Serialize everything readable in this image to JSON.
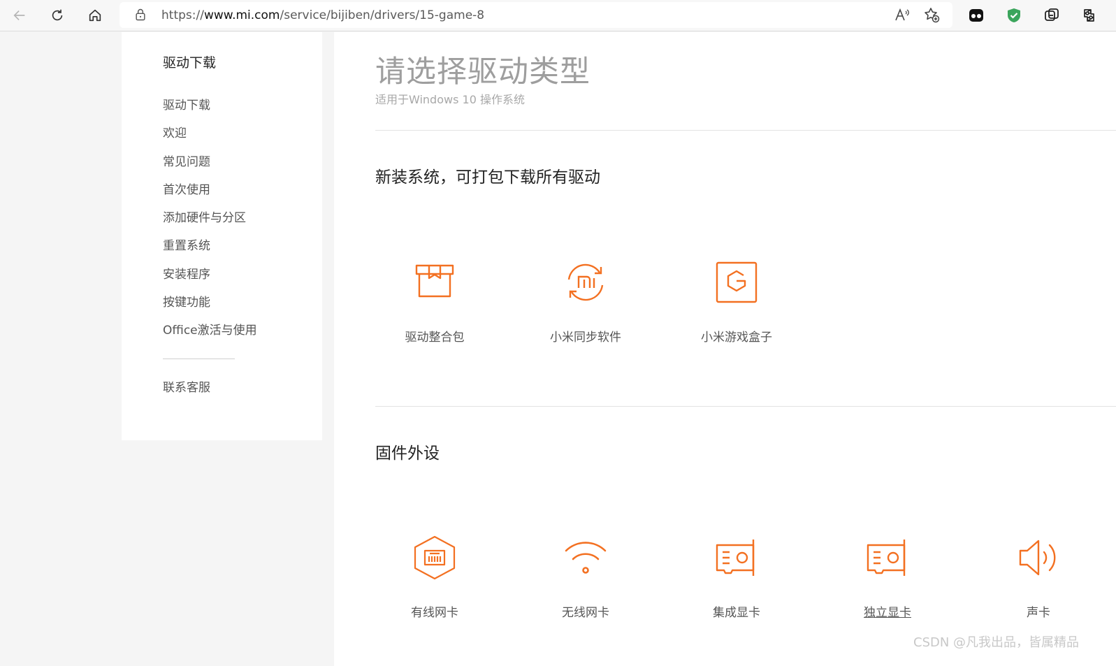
{
  "browser": {
    "url_prefix": "https://",
    "url_domain": "www.mi.com",
    "url_path": "/service/bijiben/drivers/15-game-8"
  },
  "sidebar": {
    "heading": "驱动下载",
    "items": [
      {
        "label": "驱动下载"
      },
      {
        "label": "欢迎"
      },
      {
        "label": "常见问题"
      },
      {
        "label": "首次使用"
      },
      {
        "label": "添加硬件与分区"
      },
      {
        "label": "重置系统"
      },
      {
        "label": "安装程序"
      },
      {
        "label": "按键功能"
      },
      {
        "label": "Office激活与使用"
      }
    ],
    "contact": "联系客服"
  },
  "main": {
    "title": "请选择驱动类型",
    "subtitle": "适用于Windows 10 操作系统",
    "sections": [
      {
        "title": "新装系统，可打包下载所有驱动",
        "items": [
          {
            "label": "驱动整合包",
            "icon": "package-icon"
          },
          {
            "label": "小米同步软件",
            "icon": "mi-sync-icon"
          },
          {
            "label": "小米游戏盒子",
            "icon": "game-box-icon"
          }
        ]
      },
      {
        "title": "固件外设",
        "items": [
          {
            "label": "有线网卡",
            "icon": "ethernet-icon"
          },
          {
            "label": "无线网卡",
            "icon": "wifi-icon"
          },
          {
            "label": "集成显卡",
            "icon": "graphics-card-icon"
          },
          {
            "label": "独立显卡",
            "icon": "graphics-card-icon"
          },
          {
            "label": "声卡",
            "icon": "speaker-icon"
          }
        ]
      }
    ]
  },
  "watermark": "CSDN @凡我出品，皆属精品",
  "colors": {
    "accent": "#f37021",
    "sidebar_text": "#555555",
    "title_gray": "#9e9e9e"
  }
}
